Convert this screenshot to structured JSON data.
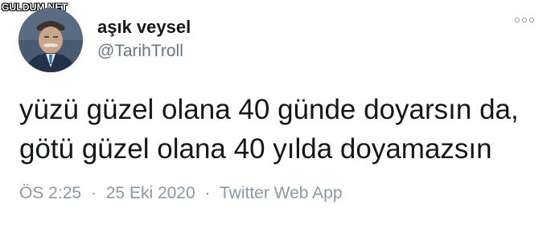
{
  "watermark": "GULDUM.NET",
  "tweet": {
    "display_name": "aşık veysel",
    "handle": "@TarihTroll",
    "text_lines": [
      "yüzü güzel olana 40 günde doyarsın da,",
      "götü güzel olana 40 yılda doyamazsın"
    ],
    "time": "ÖS 2:25",
    "date": "25 Eki 2020",
    "source": "Twitter Web App",
    "separator": "·"
  },
  "icons": {
    "more": "more-options-icon",
    "avatar": "profile-avatar"
  }
}
